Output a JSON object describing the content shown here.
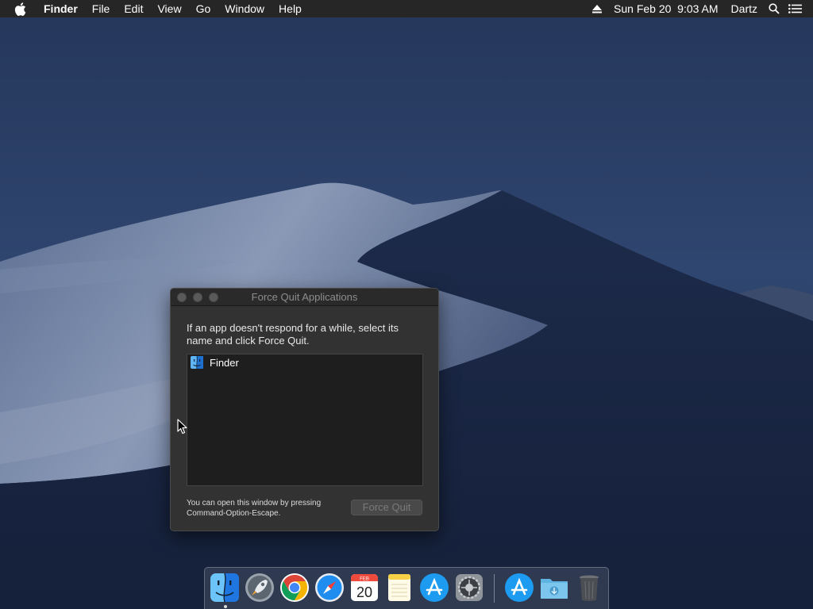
{
  "menubar": {
    "app_name": "Finder",
    "menus": [
      "File",
      "Edit",
      "View",
      "Go",
      "Window",
      "Help"
    ],
    "datetime": "Sun Feb 20  9:03 AM",
    "user": "Dartz"
  },
  "force_quit": {
    "title": "Force Quit Applications",
    "instructions": "If an app doesn't respond for a while, select its name and click Force Quit.",
    "apps": [
      {
        "name": "Finder",
        "icon": "finder-icon"
      }
    ],
    "hint_line1": "You can open this window by pressing",
    "hint_line2": "Command-Option-Escape.",
    "button_label": "Force Quit"
  },
  "dock": {
    "items": [
      {
        "name": "Finder",
        "icon": "finder-icon",
        "running": true
      },
      {
        "name": "Launchpad",
        "icon": "rocket-icon"
      },
      {
        "name": "Google Chrome",
        "icon": "chrome-icon"
      },
      {
        "name": "Safari",
        "icon": "compass-icon"
      },
      {
        "name": "Calendar",
        "icon": "calendar-icon",
        "month": "FEB",
        "day": "20"
      },
      {
        "name": "Notes",
        "icon": "notepad-icon"
      },
      {
        "name": "App Store",
        "icon": "app-store-icon"
      },
      {
        "name": "System Preferences",
        "icon": "gear-icon"
      },
      {
        "name": "App Store",
        "icon": "app-store-icon"
      },
      {
        "name": "Downloads",
        "icon": "download-folder-icon"
      },
      {
        "name": "Trash",
        "icon": "trash-icon"
      }
    ]
  },
  "colors": {
    "menubar_bg": "#262626",
    "window_bg": "#323232",
    "list_bg": "#1e1e1e",
    "accent_blue": "#1e88e5"
  }
}
